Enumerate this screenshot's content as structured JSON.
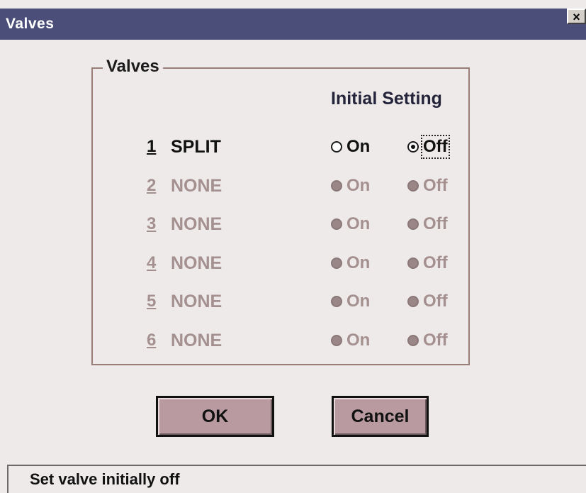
{
  "window": {
    "title": "Valves",
    "close_label": "×"
  },
  "group": {
    "title": "Valves",
    "column_header": "Initial Setting"
  },
  "valves": [
    {
      "number": "1",
      "name": "SPLIT",
      "enabled": true,
      "on_label": "On",
      "off_label": "Off",
      "selected": "Off"
    },
    {
      "number": "2",
      "name": "NONE",
      "enabled": false,
      "on_label": "On",
      "off_label": "Off",
      "selected": null
    },
    {
      "number": "3",
      "name": "NONE",
      "enabled": false,
      "on_label": "On",
      "off_label": "Off",
      "selected": null
    },
    {
      "number": "4",
      "name": "NONE",
      "enabled": false,
      "on_label": "On",
      "off_label": "Off",
      "selected": null
    },
    {
      "number": "5",
      "name": "NONE",
      "enabled": false,
      "on_label": "On",
      "off_label": "Off",
      "selected": null
    },
    {
      "number": "6",
      "name": "NONE",
      "enabled": false,
      "on_label": "On",
      "off_label": "Off",
      "selected": null
    }
  ],
  "buttons": {
    "ok_label": "OK",
    "cancel_label": "Cancel"
  },
  "status": {
    "text": "Set valve initially off"
  },
  "colors": {
    "titlebar": "#4b4e79",
    "dialog_bg": "#efeaea",
    "button_face": "#b99aa1",
    "disabled_text": "#a59090",
    "group_border": "#9a7f78"
  }
}
